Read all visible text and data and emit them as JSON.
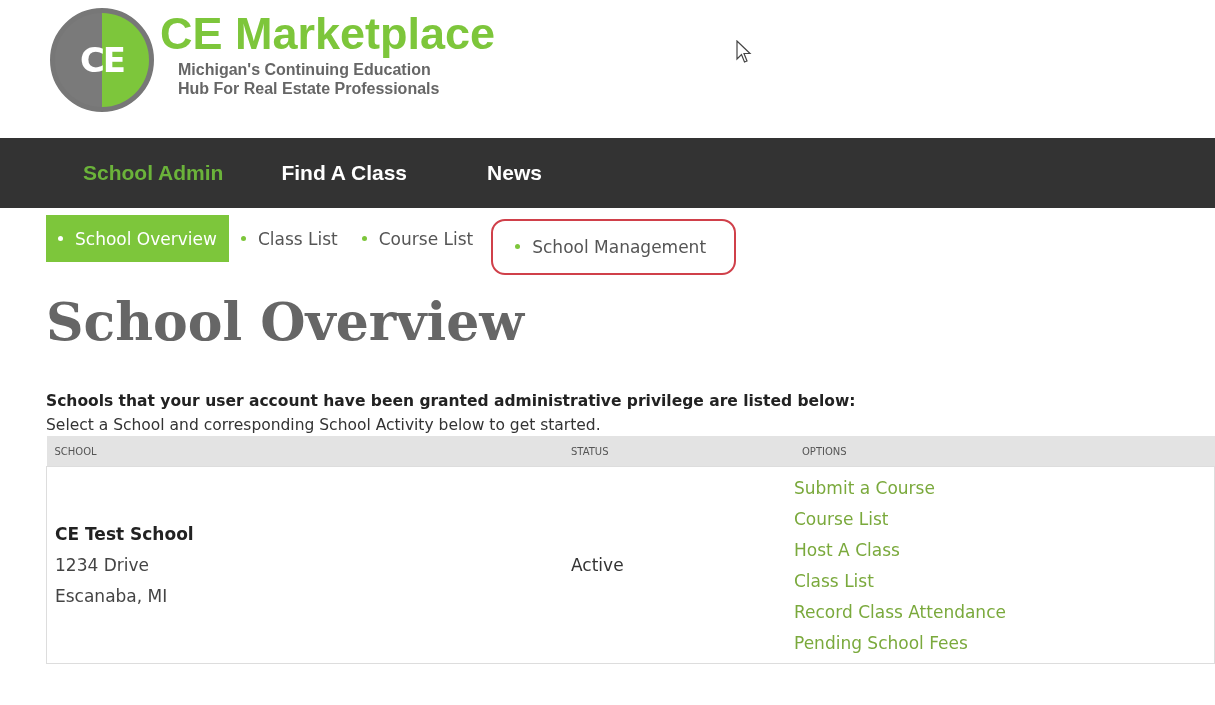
{
  "logo": {
    "mark": "CE",
    "title": "CE Marketplace",
    "tagline": [
      "Michigan's Continuing Education",
      "Hub For Real Estate Professionals"
    ]
  },
  "nav": [
    {
      "label": "School Admin",
      "selected": true
    },
    {
      "label": "Find A Class",
      "selected": false
    },
    {
      "label": "News",
      "selected": false
    }
  ],
  "subnav": [
    {
      "label": "School Overview",
      "selected": true,
      "highlighted": false
    },
    {
      "label": "Class List",
      "selected": false,
      "highlighted": false
    },
    {
      "label": "Course List",
      "selected": false,
      "highlighted": false
    },
    {
      "label": "School Management",
      "selected": false,
      "highlighted": true
    }
  ],
  "heading": "School Overview",
  "intro": "Schools that your user account have been granted administrative privilege are listed below:",
  "hint": "Select a School and corresponding School Activity below to get started.",
  "table": {
    "columns": [
      "SCHOOL",
      "STATUS",
      "OPTIONS"
    ],
    "rows": [
      {
        "school": {
          "name": "CE Test School",
          "address": [
            "1234 Drive",
            "Escanaba, MI"
          ]
        },
        "status": "Active",
        "options": [
          "Submit a Course",
          "Course List",
          "Host A Class",
          "Class List",
          "Record Class Attendance",
          "Pending School Fees"
        ]
      }
    ]
  }
}
